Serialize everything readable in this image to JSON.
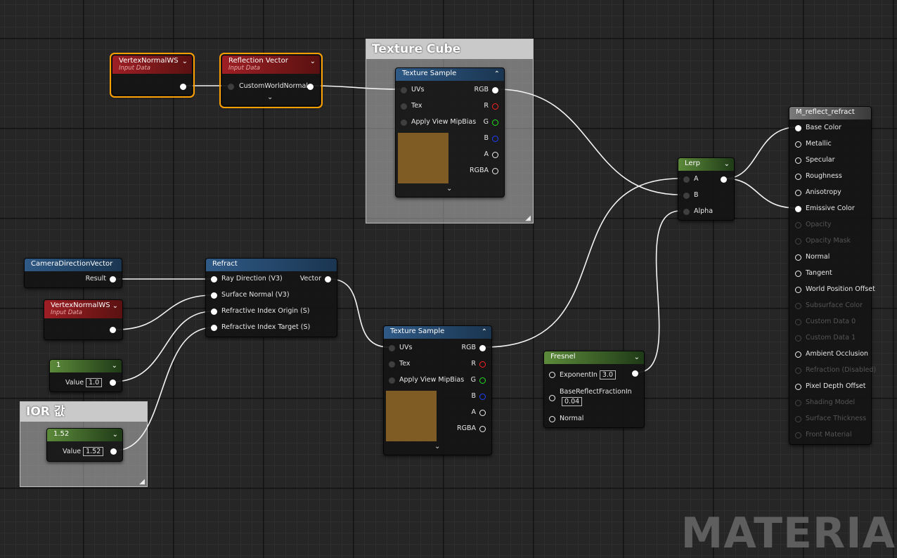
{
  "comments": {
    "texture_cube": "Texture Cube",
    "ior": "IOR 값"
  },
  "nodes": {
    "vertex_normal_top": {
      "title": "VertexNormalWS",
      "subtitle": "Input Data"
    },
    "reflection_vector": {
      "title": "Reflection Vector",
      "subtitle": "Input Data",
      "input": "CustomWorldNormal"
    },
    "texture_sample_top": {
      "title": "Texture Sample",
      "inputs": [
        "UVs",
        "Tex",
        "Apply View MipBias"
      ],
      "outputs": [
        "RGB",
        "R",
        "G",
        "B",
        "A",
        "RGBA"
      ]
    },
    "lerp": {
      "title": "Lerp",
      "inputs": [
        "A",
        "B",
        "Alpha"
      ]
    },
    "camera_direction": {
      "title": "CameraDirectionVector",
      "output": "Result"
    },
    "refract": {
      "title": "Refract",
      "inputs": [
        "Ray Direction (V3)",
        "Surface Normal (V3)",
        "Refractive Index Origin (S)",
        "Refractive Index Target (S)"
      ],
      "output": "Vector"
    },
    "vertex_normal_mid": {
      "title": "VertexNormalWS",
      "subtitle": "Input Data"
    },
    "const_one": {
      "title": "1",
      "value_label": "Value",
      "value": "1.0"
    },
    "const_ior": {
      "title": "1.52",
      "value_label": "Value",
      "value": "1.52"
    },
    "texture_sample_bottom": {
      "title": "Texture Sample",
      "inputs": [
        "UVs",
        "Tex",
        "Apply View MipBias"
      ],
      "outputs": [
        "RGB",
        "R",
        "G",
        "B",
        "A",
        "RGBA"
      ]
    },
    "fresnel": {
      "title": "Fresnel",
      "exponent_label": "ExponentIn",
      "exponent_value": "3.0",
      "base_reflect_label": "BaseReflectFractionIn",
      "base_reflect_value": "0.04",
      "normal_label": "Normal"
    },
    "material_result": {
      "title": "M_reflect_refract",
      "pins": [
        {
          "label": "Base Color",
          "state": "connected"
        },
        {
          "label": "Metallic",
          "state": "open"
        },
        {
          "label": "Specular",
          "state": "open"
        },
        {
          "label": "Roughness",
          "state": "open"
        },
        {
          "label": "Anisotropy",
          "state": "open"
        },
        {
          "label": "Emissive Color",
          "state": "connected"
        },
        {
          "label": "Opacity",
          "state": "disabled"
        },
        {
          "label": "Opacity Mask",
          "state": "disabled"
        },
        {
          "label": "Normal",
          "state": "open"
        },
        {
          "label": "Tangent",
          "state": "open"
        },
        {
          "label": "World Position Offset",
          "state": "open"
        },
        {
          "label": "Subsurface Color",
          "state": "disabled"
        },
        {
          "label": "Custom Data 0",
          "state": "disabled"
        },
        {
          "label": "Custom Data 1",
          "state": "disabled"
        },
        {
          "label": "Ambient Occlusion",
          "state": "open"
        },
        {
          "label": "Refraction (Disabled)",
          "state": "disabled"
        },
        {
          "label": "Pixel Depth Offset",
          "state": "open"
        },
        {
          "label": "Shading Model",
          "state": "disabled"
        },
        {
          "label": "Surface Thickness",
          "state": "disabled"
        },
        {
          "label": "Front Material",
          "state": "disabled"
        }
      ]
    }
  },
  "colors": {
    "texture_swatch": "#7e5c23",
    "selection_outline": "#ffa000",
    "wire": "#ffffff"
  },
  "watermark": "MATERIA"
}
